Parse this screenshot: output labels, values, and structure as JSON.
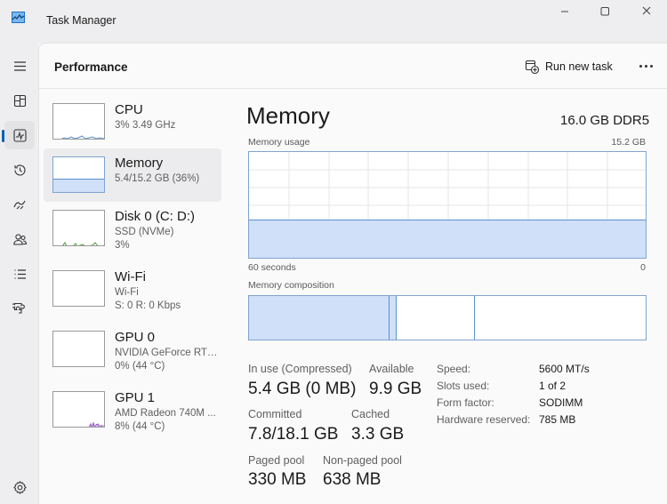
{
  "window": {
    "title": "Task Manager"
  },
  "nav": {
    "items": [
      {
        "name": "hamburger",
        "icon": "menu-icon"
      },
      {
        "name": "processes",
        "icon": "processes-icon"
      },
      {
        "name": "performance",
        "icon": "performance-icon",
        "active": true
      },
      {
        "name": "app-history",
        "icon": "history-icon"
      },
      {
        "name": "startup-apps",
        "icon": "startup-icon"
      },
      {
        "name": "users",
        "icon": "users-icon"
      },
      {
        "name": "details",
        "icon": "details-icon"
      },
      {
        "name": "services",
        "icon": "services-icon"
      },
      {
        "name": "settings",
        "icon": "gear-icon"
      }
    ]
  },
  "header": {
    "title": "Performance",
    "run_new_task": "Run new task"
  },
  "devices": [
    {
      "name": "CPU",
      "line1": "3%  3.49 GHz",
      "line2": ""
    },
    {
      "name": "Memory",
      "line1": "5.4/15.2 GB (36%)",
      "line2": "",
      "selected": true
    },
    {
      "name": "Disk 0 (C: D:)",
      "line1": "SSD (NVMe)",
      "line2": "3%"
    },
    {
      "name": "Wi-Fi",
      "line1": "Wi-Fi",
      "line2": "S: 0 R: 0 Kbps"
    },
    {
      "name": "GPU 0",
      "line1": "NVIDIA GeForce RTX...",
      "line2": "0% (44 °C)"
    },
    {
      "name": "GPU 1",
      "line1": "AMD Radeon 740M ...",
      "line2": "8% (44 °C)"
    }
  ],
  "detail": {
    "title": "Memory",
    "spec": "16.0 GB DDR5",
    "usage_label": "Memory usage",
    "usage_max": "15.2 GB",
    "time_left": "60 seconds",
    "time_right": "0",
    "usage_fraction": 0.36,
    "composition_label": "Memory composition",
    "stats": {
      "in_use_label": "In use (Compressed)",
      "in_use_value": "5.4 GB (0 MB)",
      "available_label": "Available",
      "available_value": "9.9 GB",
      "committed_label": "Committed",
      "committed_value": "7.8/18.1 GB",
      "cached_label": "Cached",
      "cached_value": "3.3 GB",
      "paged_label": "Paged pool",
      "paged_value": "330 MB",
      "nonpaged_label": "Non-paged pool",
      "nonpaged_value": "638 MB"
    },
    "props": [
      {
        "key": "Speed:",
        "value": "5600 MT/s"
      },
      {
        "key": "Slots used:",
        "value": "1 of 2"
      },
      {
        "key": "Form factor:",
        "value": "SODIMM"
      },
      {
        "key": "Hardware reserved:",
        "value": "785 MB"
      }
    ]
  },
  "colors": {
    "accent": "#005fb8",
    "memory_fill": "#cfe0f8",
    "memory_line": "#5b8fcd",
    "cpu_line": "#5b8fcd",
    "disk_line": "#4a9a3a",
    "gpu_line": "#8a3fc4"
  }
}
